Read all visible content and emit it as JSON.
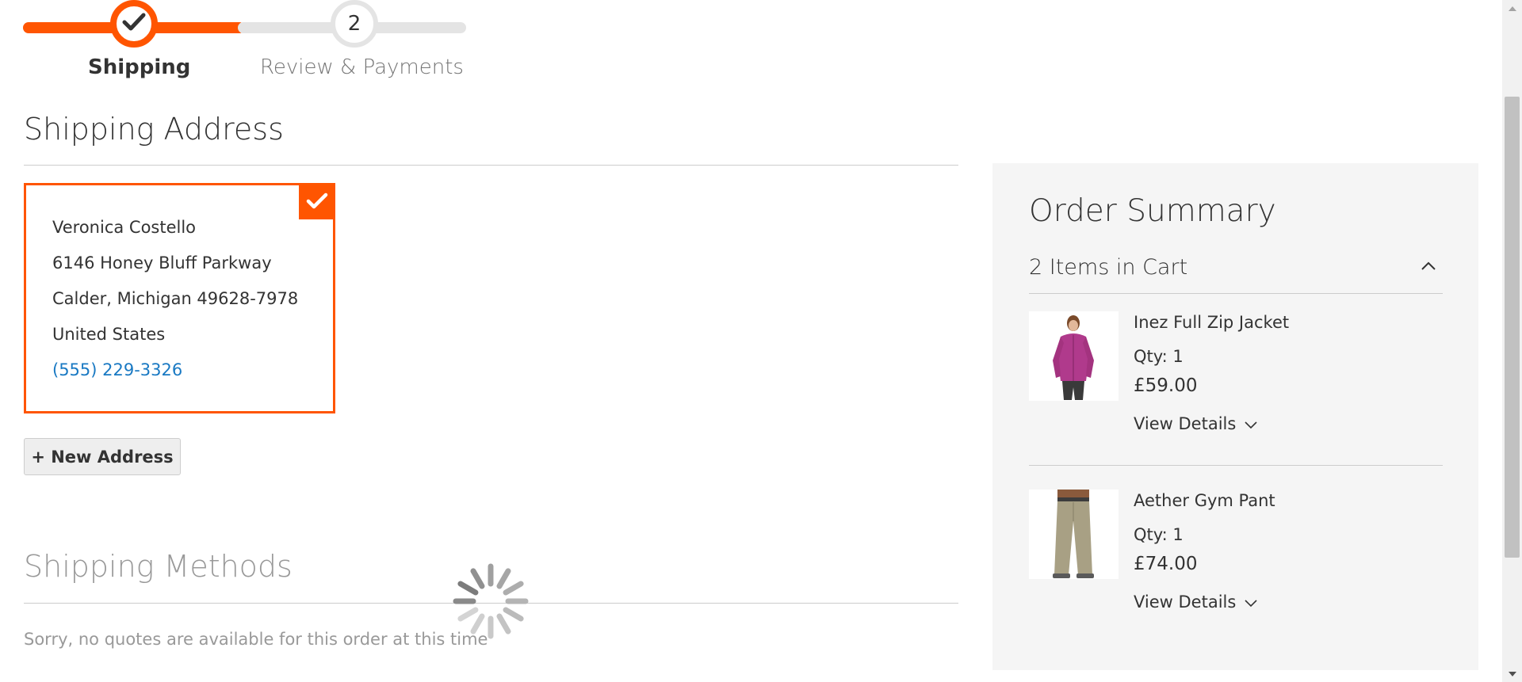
{
  "progress": {
    "steps": [
      {
        "label": "Shipping",
        "status": "complete"
      },
      {
        "label": "Review & Payments",
        "number": "2",
        "status": "pending"
      }
    ]
  },
  "shipping_address": {
    "title": "Shipping Address",
    "card": {
      "name": "Veronica Costello",
      "street": "6146 Honey Bluff Parkway",
      "city_line": "Calder, Michigan 49628-7978",
      "country": "United States",
      "phone": "(555) 229-3326",
      "selected": true
    },
    "new_address_label": "+ New Address"
  },
  "shipping_methods": {
    "title": "Shipping Methods",
    "message": "Sorry, no quotes are available for this order at this time",
    "loading": true
  },
  "order_summary": {
    "title": "Order Summary",
    "items_in_cart": "2 Items in Cart",
    "items": [
      {
        "name": "Inez Full Zip Jacket",
        "qty": "Qty: 1",
        "price": "£59.00",
        "details_label": "View Details"
      },
      {
        "name": "Aether Gym Pant",
        "qty": "Qty: 1",
        "price": "£74.00",
        "details_label": "View Details"
      }
    ]
  },
  "colors": {
    "accent": "#ff5501",
    "link": "#1979c3",
    "summary_bg": "#f5f5f5"
  }
}
